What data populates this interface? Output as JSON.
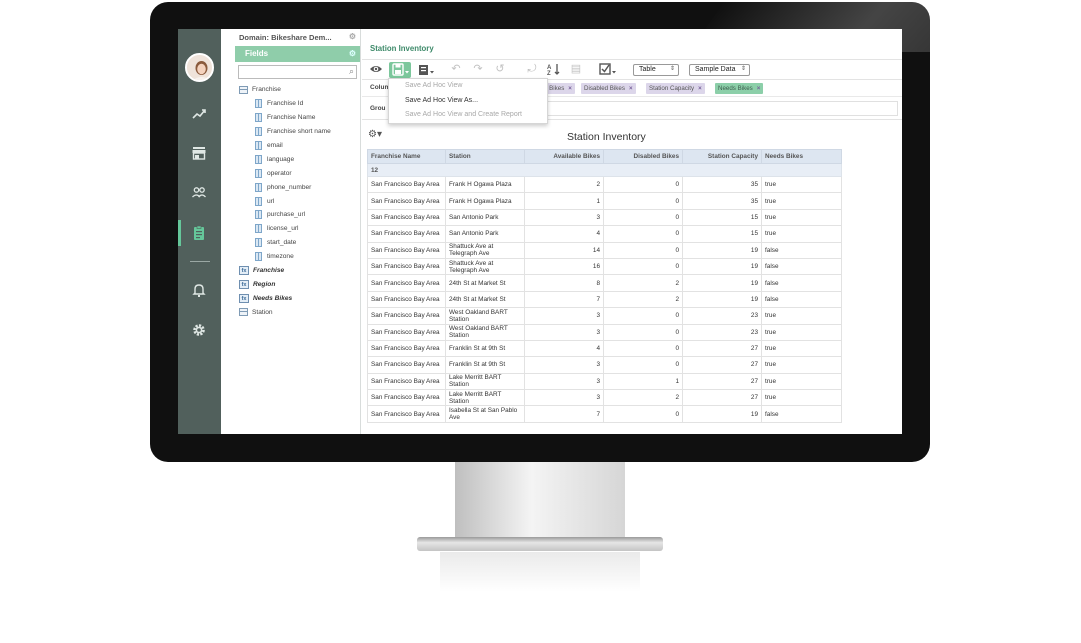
{
  "left_panel": {
    "domain_label": "Domain: Bikeshare Dem...",
    "fields_header": "Fields",
    "search_placeholder": "",
    "tree": [
      {
        "label": "Franchise",
        "kind": "table",
        "level": 0
      },
      {
        "label": "Franchise Id",
        "kind": "field",
        "level": 1
      },
      {
        "label": "Franchise Name",
        "kind": "field",
        "level": 1
      },
      {
        "label": "Franchise short name",
        "kind": "field",
        "level": 1
      },
      {
        "label": "email",
        "kind": "field",
        "level": 1
      },
      {
        "label": "language",
        "kind": "field",
        "level": 1
      },
      {
        "label": "operator",
        "kind": "field",
        "level": 1
      },
      {
        "label": "phone_number",
        "kind": "field",
        "level": 1
      },
      {
        "label": "url",
        "kind": "field",
        "level": 1
      },
      {
        "label": "purchase_url",
        "kind": "field",
        "level": 1
      },
      {
        "label": "license_url",
        "kind": "field",
        "level": 1
      },
      {
        "label": "start_date",
        "kind": "field",
        "level": 1
      },
      {
        "label": "timezone",
        "kind": "field",
        "level": 1
      },
      {
        "label": "Franchise",
        "kind": "calc",
        "level": 0
      },
      {
        "label": "Region",
        "kind": "calc",
        "level": 0
      },
      {
        "label": "Needs Bikes",
        "kind": "calc",
        "level": 0
      },
      {
        "label": "Station",
        "kind": "table",
        "level": 0
      }
    ]
  },
  "main": {
    "title": "Station Inventory",
    "toolbar": {
      "view_type": "Table",
      "data_mode": "Sample Data"
    },
    "columns_label": "Colum",
    "groups_label": "Grou",
    "column_chips": [
      {
        "label": "n Bikes",
        "style": "purple"
      },
      {
        "label": "Disabled Bikes",
        "style": "purple"
      },
      {
        "label": "Station Capacity",
        "style": "purple"
      },
      {
        "label": "Needs Bikes",
        "style": "green"
      }
    ],
    "chip_remove": "×",
    "save_menu": [
      {
        "label": "Save Ad Hoc View",
        "enabled": false
      },
      {
        "label": "Save Ad Hoc View As...",
        "enabled": true
      },
      {
        "label": "Save Ad Hoc View and Create Report",
        "enabled": false
      }
    ],
    "report_title": "Station Inventory",
    "table": {
      "headers": [
        "Franchise Name",
        "Station",
        "Available Bikes",
        "Disabled Bikes",
        "Station Capacity",
        "Needs Bikes"
      ],
      "group_value": "12",
      "rows": [
        [
          "San Francisco Bay Area",
          "Frank H Ogawa Plaza",
          "2",
          "0",
          "35",
          "true"
        ],
        [
          "San Francisco Bay Area",
          "Frank H Ogawa Plaza",
          "1",
          "0",
          "35",
          "true"
        ],
        [
          "San Francisco Bay Area",
          "San Antonio Park",
          "3",
          "0",
          "15",
          "true"
        ],
        [
          "San Francisco Bay Area",
          "San Antonio Park",
          "4",
          "0",
          "15",
          "true"
        ],
        [
          "San Francisco Bay Area",
          "Shattuck Ave at Telegraph Ave",
          "14",
          "0",
          "19",
          "false"
        ],
        [
          "San Francisco Bay Area",
          "Shattuck Ave at Telegraph Ave",
          "16",
          "0",
          "19",
          "false"
        ],
        [
          "San Francisco Bay Area",
          "24th St at Market St",
          "8",
          "2",
          "19",
          "false"
        ],
        [
          "San Francisco Bay Area",
          "24th St at Market St",
          "7",
          "2",
          "19",
          "false"
        ],
        [
          "San Francisco Bay Area",
          "West Oakland BART Station",
          "3",
          "0",
          "23",
          "true"
        ],
        [
          "San Francisco Bay Area",
          "West Oakland BART Station",
          "3",
          "0",
          "23",
          "true"
        ],
        [
          "San Francisco Bay Area",
          "Franklin St at 9th St",
          "4",
          "0",
          "27",
          "true"
        ],
        [
          "San Francisco Bay Area",
          "Franklin St at 9th St",
          "3",
          "0",
          "27",
          "true"
        ],
        [
          "San Francisco Bay Area",
          "Lake Merritt BART Station",
          "3",
          "1",
          "27",
          "true"
        ],
        [
          "San Francisco Bay Area",
          "Lake Merritt BART Station",
          "3",
          "2",
          "27",
          "true"
        ],
        [
          "San Francisco Bay Area",
          "Isabella St at San Pablo Ave",
          "7",
          "0",
          "19",
          "false"
        ]
      ]
    }
  },
  "colors": {
    "accent": "#65c79a",
    "rail": "#51605c",
    "fields_header": "#8fcdaa",
    "title": "#3e8a6a"
  },
  "icons": {
    "rail": [
      "trend-icon",
      "store-icon",
      "people-icon",
      "clipboard-icon",
      "bell-icon",
      "gear-icon"
    ],
    "toolbar": [
      "eye-icon",
      "save-icon",
      "export-icon",
      "undo-icon",
      "redo-icon",
      "reset-icon",
      "pivot-icon",
      "sort-icon",
      "query-icon",
      "display-options-icon"
    ]
  }
}
